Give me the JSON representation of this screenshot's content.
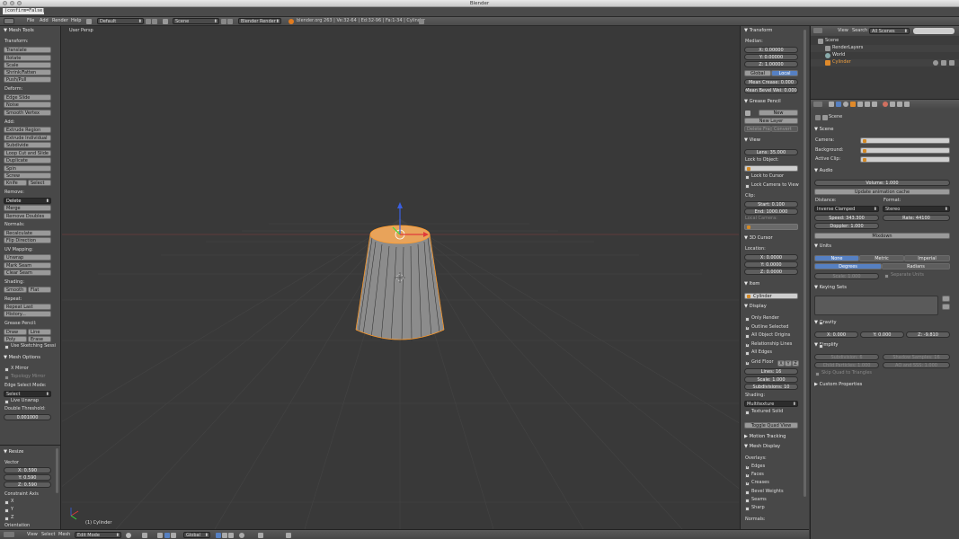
{
  "window": {
    "title": "Blender",
    "confirm_text": "(confirm=False)"
  },
  "topbar": {
    "menus": [
      "File",
      "Add",
      "Render",
      "Help"
    ],
    "layout": "Default",
    "scene": "Scene",
    "engine": "Blender Render",
    "stats": "blender.org 263 | Ve:32-64 | Ed:32-96 | Fa:1-34 | Cylinder"
  },
  "toolshelf": {
    "title": "Mesh Tools",
    "transform_label": "Transform:",
    "transform": [
      "Translate",
      "Rotate",
      "Scale",
      "Shrink/Fatten",
      "Push/Pull"
    ],
    "deform_label": "Deform:",
    "deform": [
      "Edge Slide",
      "Noise",
      "Smooth Vertex"
    ],
    "add_label": "Add:",
    "add": [
      "Extrude Region",
      "Extrude Individual",
      "Subdivide",
      "Loop Cut and Slide",
      "Duplicate",
      "Spin",
      "Screw"
    ],
    "knife": "Knife",
    "select": "Select",
    "remove_label": "Remove:",
    "remove_delete": "Delete",
    "remove": [
      "Merge",
      "Remove Doubles"
    ],
    "normals_label": "Normals:",
    "normals": [
      "Recalculate",
      "Flip Direction"
    ],
    "uv_label": "UV Mapping:",
    "uv": [
      "Unwrap",
      "Mark Seam",
      "Clear Seam"
    ],
    "shading_label": "Shading:",
    "smooth": "Smooth",
    "flat": "Flat",
    "repeat_label": "Repeat:",
    "repeat": [
      "Repeat Last",
      "History..."
    ],
    "gp_label": "Grease Pencil:",
    "draw": "Draw",
    "line": "Line",
    "poly": "Poly",
    "erase": "Erase",
    "use_sketching": "Use Sketching Sessi",
    "mesh_options": "Mesh Options",
    "x_mirror": "X Mirror",
    "topology_mirror": "Topology Mirror",
    "edge_select_label": "Edge Select Mode:",
    "edge_select_value": "Select",
    "live_unwrap": "Live Unwrap",
    "double_threshold_label": "Double Threshold:",
    "double_threshold": "0.001000"
  },
  "operator": {
    "title": "Resize",
    "vector_label": "Vector",
    "vx": "X: 0.590",
    "vy": "Y: 0.590",
    "vz": "Z: 0.590",
    "constraint_label": "Constraint Axis",
    "axes": [
      "X",
      "Y",
      "Z"
    ],
    "orientation_label": "Orientation"
  },
  "viewport": {
    "label": "User Persp",
    "object_label": "(1) Cylinder"
  },
  "bottombar": {
    "menus": [
      "View",
      "Select",
      "Mesh"
    ],
    "mode": "Edit Mode",
    "orientation": "Global"
  },
  "npanel": {
    "transform_title": "Transform",
    "median_label": "Median:",
    "x": "X: 0.00000",
    "y": "Y: 0.00000",
    "z": "Z: 1.00000",
    "global": "Global",
    "local": "Local",
    "crease": "Mean Crease: 0.000",
    "bevel": "Mean Bevel Wei: 0.000",
    "gp_title": "Grease Pencil",
    "new": "New",
    "new_layer": "New Layer",
    "delete_frame": "Delete Frame",
    "convert": "Convert",
    "view_title": "View",
    "lens": "Lens: 35.000",
    "lock_object_label": "Lock to Object:",
    "lock_cursor": "Lock to Cursor",
    "lock_camera": "Lock Camera to View",
    "clip_label": "Clip:",
    "clip_start": "Start: 0.100",
    "clip_end": "End: 1000.000",
    "local_camera_label": "Local Camera:",
    "cursor_title": "3D Cursor",
    "location_label": "Location:",
    "cx": "X: 0.0000",
    "cy": "Y: 0.0000",
    "cz": "Z: 0.0000",
    "item_title": "Item",
    "item_name": "Cylinder",
    "display_title": "Display",
    "only_render": "Only Render",
    "outline_selected": "Outline Selected",
    "all_origins": "All Object Origins",
    "relationship_lines": "Relationship Lines",
    "all_edges": "All Edges",
    "grid_floor": "Grid Floor",
    "gx": "X",
    "gy": "Y",
    "gz": "Z",
    "lines": "Lines: 16",
    "scale": "Scale: 1.000",
    "subdivisions": "Subdivisions: 10",
    "shading_label": "Shading:",
    "shading_value": "Multitexture",
    "textured_solid": "Textured Solid",
    "toggle_quad": "Toggle Quad View",
    "motion_tracking": "Motion Tracking",
    "mesh_display": "Mesh Display",
    "overlays_label": "Overlays:",
    "edges": "Edges",
    "faces": "Faces",
    "creases": "Creases",
    "bevel_weights": "Bevel Weights",
    "seams": "Seams",
    "sharp": "Sharp",
    "normals_label": "Normals:"
  },
  "outliner": {
    "view": "View",
    "search": "Search",
    "filter": "All Scenes",
    "items": [
      "Scene",
      "RenderLayers",
      "World",
      "Cylinder"
    ]
  },
  "properties": {
    "breadcrumb": "Scene",
    "scene_title": "Scene",
    "camera_label": "Camera:",
    "background_label": "Background:",
    "active_clip_label": "Active Clip:",
    "audio_title": "Audio",
    "volume": "Volume: 1.000",
    "update_cache": "Update animation cache",
    "distance_label": "Distance:",
    "format_label": "Format:",
    "distance": "Inverse Clamped",
    "format": "Stereo",
    "speed": "Speed: 343.300",
    "rate": "Rate: 44100",
    "doppler": "Doppler: 1.000",
    "mixdown": "Mixdown",
    "units_title": "Units",
    "none": "None",
    "metric": "Metric",
    "imperial": "Imperial",
    "degrees": "Degrees",
    "radians": "Radians",
    "unit_scale": "Scale: 1.000",
    "separate_units": "Separate Units",
    "keying_title": "Keying Sets",
    "gravity_title": "Gravity",
    "gx": "X: 0.000",
    "gy": "Y: 0.000",
    "gz": "Z: -9.810",
    "simplify_title": "Simplify",
    "subdivision": "Subdivision: 6",
    "shadow_samples": "Shadow Samples: 16",
    "child_particles": "Child Particles: 1.000",
    "ao_sss": "AO and SSS: 1.000",
    "skip_quad": "Skip Quad to Triangles",
    "custom_props": "Custom Properties"
  }
}
